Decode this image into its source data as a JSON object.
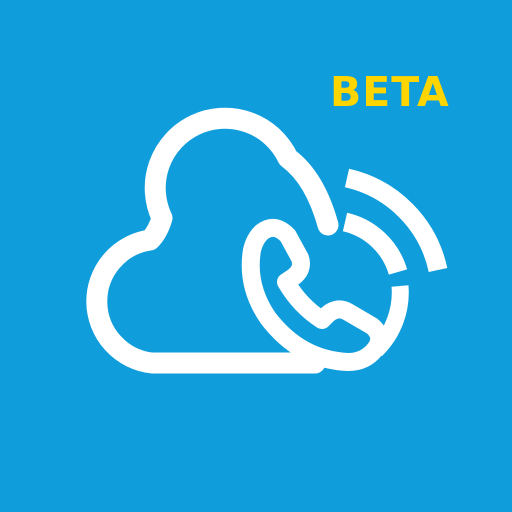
{
  "icon": {
    "name": "cloud-phone-icon",
    "background_color": "#0f9ddb",
    "foreground_color": "#ffffff",
    "badge": {
      "label": "BETA",
      "color": "#ffd500"
    }
  }
}
